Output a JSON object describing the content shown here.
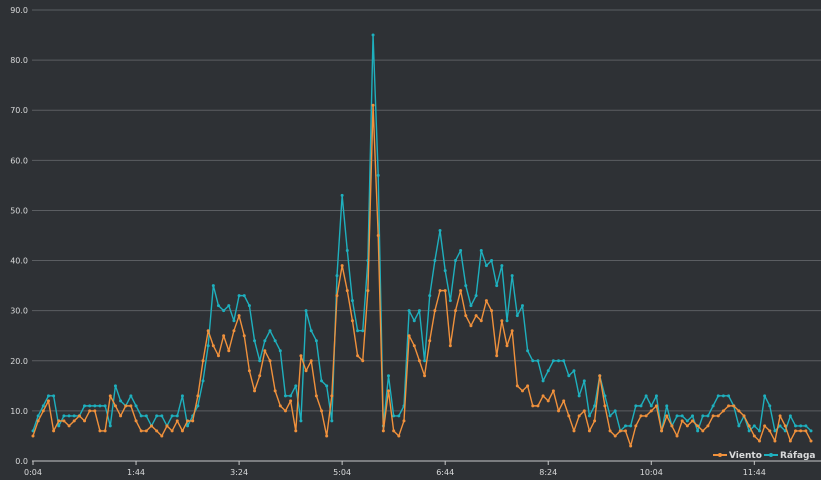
{
  "chart_data": {
    "type": "line",
    "ylim": [
      0,
      90
    ],
    "y_ticks": [
      "0.0",
      "10.0",
      "20.0",
      "30.0",
      "40.0",
      "50.0",
      "60.0",
      "70.0",
      "80.0",
      "90.0"
    ],
    "x_tick_labels": [
      "0:04",
      "1:44",
      "3:24",
      "5:04",
      "6:44",
      "8:24",
      "10:04",
      "11:44"
    ],
    "x_tick_indices": [
      0,
      20,
      40,
      60,
      80,
      100,
      120,
      140
    ],
    "legend": {
      "position": "bottom-right"
    },
    "series": [
      {
        "name": "Viento",
        "color": "#f0913c",
        "values": [
          5,
          8,
          10,
          12,
          6,
          8,
          8,
          7,
          8,
          9,
          8,
          10,
          10,
          6,
          6,
          13,
          11,
          9,
          11,
          11,
          8,
          6,
          6,
          7,
          6,
          5,
          7,
          6,
          8,
          6,
          8,
          8,
          13,
          20,
          26,
          23,
          21,
          25,
          22,
          26,
          29,
          25,
          18,
          14,
          17,
          22,
          20,
          14,
          11,
          10,
          12,
          6,
          21,
          18,
          20,
          13,
          10,
          5,
          13,
          33,
          39,
          34,
          28,
          21,
          20,
          34,
          71,
          45,
          6,
          14,
          6,
          5,
          8,
          25,
          23,
          20,
          17,
          24,
          30,
          34,
          34,
          23,
          30,
          34,
          29,
          27,
          29,
          28,
          32,
          30,
          21,
          28,
          23,
          26,
          15,
          14,
          15,
          11,
          11,
          13,
          12,
          14,
          10,
          12,
          9,
          6,
          9,
          10,
          6,
          8,
          17,
          11,
          6,
          5,
          6,
          6,
          3,
          7,
          9,
          9,
          10,
          11,
          6,
          9,
          7,
          5,
          8,
          7,
          8,
          7,
          6,
          7,
          9,
          9,
          10,
          11,
          11,
          10,
          9,
          7,
          5,
          4,
          7,
          6,
          4,
          9,
          7,
          4,
          6,
          6,
          6,
          4
        ],
        "legend_label": "Viento"
      },
      {
        "name": "Ráfaga",
        "color": "#1eb0be",
        "values": [
          6,
          9,
          11,
          13,
          13,
          7,
          9,
          9,
          9,
          9,
          11,
          11,
          11,
          11,
          11,
          7,
          15,
          12,
          11,
          13,
          11,
          9,
          9,
          7,
          9,
          9,
          7,
          9,
          9,
          13,
          7,
          9,
          11,
          16,
          23,
          35,
          31,
          30,
          31,
          28,
          33,
          33,
          31,
          24,
          20,
          24,
          26,
          24,
          22,
          13,
          13,
          15,
          8,
          30,
          26,
          24,
          16,
          15,
          8,
          37,
          53,
          42,
          32,
          26,
          26,
          40,
          85,
          57,
          7,
          17,
          9,
          9,
          11,
          30,
          28,
          30,
          20,
          33,
          40,
          46,
          38,
          32,
          40,
          42,
          35,
          31,
          33,
          42,
          39,
          40,
          35,
          39,
          28,
          37,
          29,
          31,
          22,
          20,
          20,
          16,
          18,
          20,
          20,
          20,
          17,
          18,
          13,
          16,
          9,
          11,
          17,
          13,
          9,
          10,
          6,
          7,
          7,
          11,
          11,
          13,
          11,
          13,
          6,
          11,
          7,
          9,
          9,
          8,
          9,
          6,
          9,
          9,
          11,
          13,
          13,
          13,
          11,
          7,
          9,
          6,
          7,
          6,
          13,
          11,
          6,
          7,
          6,
          9,
          7,
          7,
          7,
          6
        ],
        "legend_label": "Ráfaga"
      }
    ]
  }
}
